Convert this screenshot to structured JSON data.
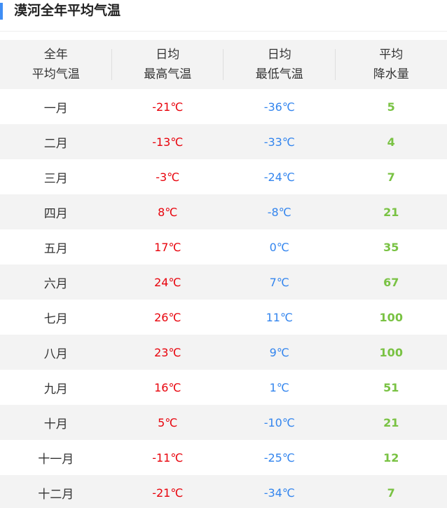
{
  "title": "漠河全年平均气温",
  "colors": {
    "accent": "#3f8ef5",
    "high": "#e8020b",
    "low": "#3385ee",
    "rain": "#79c243"
  },
  "headers": [
    {
      "line1": "全年",
      "line2": "平均气温"
    },
    {
      "line1": "日均",
      "line2": "最高气温"
    },
    {
      "line1": "日均",
      "line2": "最低气温"
    },
    {
      "line1": "平均",
      "line2": "降水量"
    }
  ],
  "rows": [
    {
      "month": "一月",
      "high": "-21℃",
      "low": "-36℃",
      "rain": "5"
    },
    {
      "month": "二月",
      "high": "-13℃",
      "low": "-33℃",
      "rain": "4"
    },
    {
      "month": "三月",
      "high": "-3℃",
      "low": "-24℃",
      "rain": "7"
    },
    {
      "month": "四月",
      "high": "8℃",
      "low": "-8℃",
      "rain": "21"
    },
    {
      "month": "五月",
      "high": "17℃",
      "low": "0℃",
      "rain": "35"
    },
    {
      "month": "六月",
      "high": "24℃",
      "low": "7℃",
      "rain": "67"
    },
    {
      "month": "七月",
      "high": "26℃",
      "low": "11℃",
      "rain": "100"
    },
    {
      "month": "八月",
      "high": "23℃",
      "low": "9℃",
      "rain": "100"
    },
    {
      "month": "九月",
      "high": "16℃",
      "low": "1℃",
      "rain": "51"
    },
    {
      "month": "十月",
      "high": "5℃",
      "low": "-10℃",
      "rain": "21"
    },
    {
      "month": "十一月",
      "high": "-11℃",
      "low": "-25℃",
      "rain": "12"
    },
    {
      "month": "十二月",
      "high": "-21℃",
      "low": "-34℃",
      "rain": "7"
    }
  ]
}
